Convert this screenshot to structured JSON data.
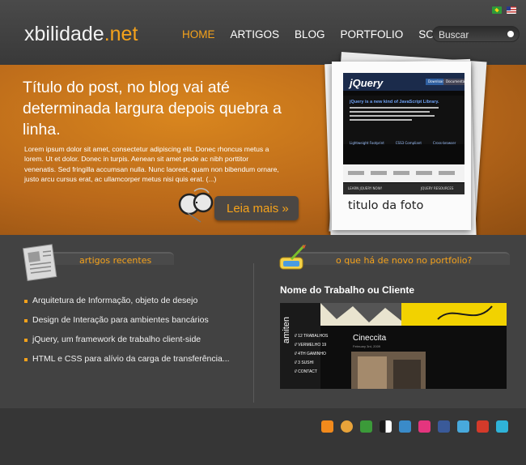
{
  "site": {
    "logo_main": "xbilidade",
    "logo_tld": ".net"
  },
  "header": {
    "nav": [
      "HOME",
      "ARTIGOS",
      "BLOG",
      "PORTFOLIO",
      "SOBRE"
    ],
    "active_index": 0,
    "search_placeholder": "Buscar"
  },
  "hero": {
    "title": "Título do post, no blog vai até determinada largura depois quebra  a linha.",
    "text": "Lorem ipsum dolor sit amet, consectetur adipiscing elit. Donec rhoncus metus a lorem. Ut et dolor. Donec in turpis. Aenean sit amet pede ac nibh porttitor venenatis. Sed fringilla accumsan nulla. Nunc laoreet, quam non bibendum ornare, justo arcu cursus erat, ac ullamcorper metus nisi quis erat. (...)",
    "read_more": "Leia mais »",
    "photo_caption": "titulo da foto"
  },
  "photo_screen": {
    "logo": "jQuery",
    "buttons": [
      "Download",
      "Documentation"
    ],
    "headline": "jQuery is a new kind of JavaScript Library.",
    "features": [
      "Lightweight Footprint",
      "CSS3 Compliant",
      "Cross-browser"
    ],
    "learn": "LEARN JQUERY NOW!",
    "resources": "JQUERY RESOURCES"
  },
  "recent": {
    "title": "artigos recentes",
    "items": [
      "Arquitetura de Informação, objeto de desejo",
      "Design de Interação para ambientes bancários",
      "jQuery, um framework de trabalho client-side",
      "HTML e CSS para alívio da carga de transferência..."
    ]
  },
  "portfolio": {
    "title": "o que há de novo no portfolio?",
    "work_title": "Nome do Trabalho ou Cliente",
    "thumb_brand": "amiten",
    "thumb_items": [
      "// 12 TRABALHOS",
      "// VERMELHO 19",
      "// 4TH GAMINHO",
      "// 3 SUSHI",
      "// CONTACT"
    ],
    "thumb_heading": "Cineccita",
    "thumb_date": "February 3rd, 2009"
  },
  "social_icons": [
    "rss-icon",
    "delicious-icon",
    "chat-icon",
    "digg-icon",
    "stumbleupon-icon",
    "flickr-icon",
    "facebook-icon",
    "twitter-icon",
    "youtube-icon",
    "vimeo-icon"
  ],
  "colors": {
    "accent": "#f5a21b",
    "hero": "#c47520",
    "background": "#3a3a3a"
  }
}
